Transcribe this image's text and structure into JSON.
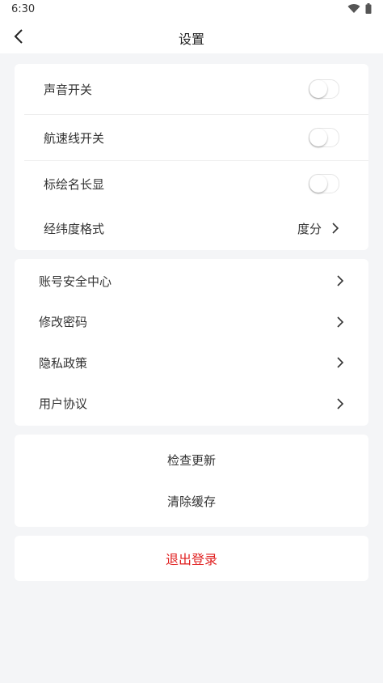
{
  "status_bar": {
    "time": "6:30"
  },
  "header": {
    "title": "设置"
  },
  "display_settings": {
    "sound": {
      "label": "声音开关",
      "on": false
    },
    "course_line": {
      "label": "航速线开关",
      "on": false
    },
    "label_display": {
      "label": "标绘名长显",
      "on": false
    },
    "coordinate_format": {
      "label": "经纬度格式",
      "value": "度分"
    }
  },
  "account_settings": {
    "items": [
      {
        "label": "账号安全中心"
      },
      {
        "label": "修改密码"
      },
      {
        "label": "隐私政策"
      },
      {
        "label": "用户协议"
      }
    ]
  },
  "app_actions": {
    "check_update": "检查更新",
    "clear_cache": "清除缓存"
  },
  "logout": {
    "label": "退出登录",
    "color": "#e02020"
  },
  "icons": {
    "back": "chevron-left-icon",
    "chevron": "chevron-right-icon",
    "wifi": "wifi-icon",
    "battery": "battery-icon"
  }
}
